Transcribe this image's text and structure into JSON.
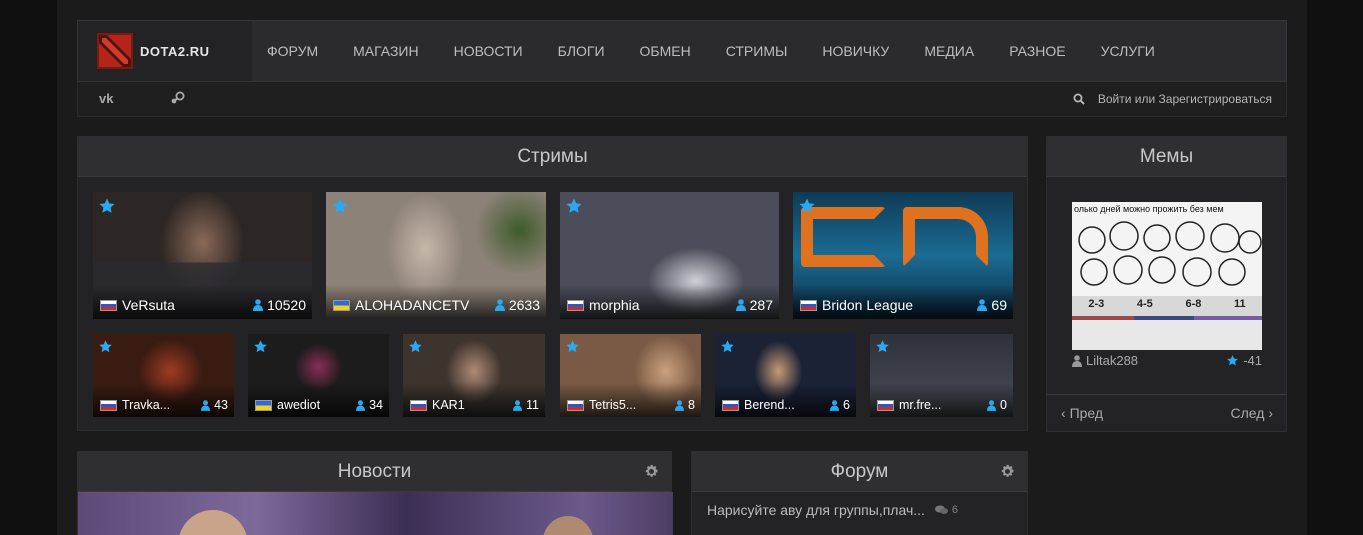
{
  "site": {
    "logo_text": "DOTA2.RU"
  },
  "nav": [
    "ФОРУМ",
    "МАГАЗИН",
    "НОВОСТИ",
    "БЛОГИ",
    "ОБМЕН",
    "СТРИМЫ",
    "НОВИЧКУ",
    "МЕДИА",
    "РАЗНОЕ",
    "УСЛУГИ"
  ],
  "subnav": {
    "vk": "vk",
    "login": "Войти или Зарегистрироваться"
  },
  "streams": {
    "title": "Стримы",
    "big": [
      {
        "name": "VeRsuta",
        "viewers": "10520",
        "flag": "ru"
      },
      {
        "name": "ALOHADANCETV",
        "viewers": "2633",
        "flag": "ua"
      },
      {
        "name": "morphia",
        "viewers": "287",
        "flag": "ru"
      },
      {
        "name": "Bridon League",
        "viewers": "69",
        "flag": "ru"
      }
    ],
    "small": [
      {
        "name": "Travka...",
        "viewers": "43",
        "flag": "ru"
      },
      {
        "name": "awediot",
        "viewers": "34",
        "flag": "ua"
      },
      {
        "name": "KAR1",
        "viewers": "11",
        "flag": "ru"
      },
      {
        "name": "Tetris5...",
        "viewers": "8",
        "flag": "ru"
      },
      {
        "name": "Berend...",
        "viewers": "6",
        "flag": "ru"
      },
      {
        "name": "mr.fre...",
        "viewers": "0",
        "flag": "ru"
      }
    ]
  },
  "memes": {
    "title": "Мемы",
    "caption": "олько дней можно прожить без мем",
    "scale": [
      "2-3",
      "4-5",
      "6-8",
      "11"
    ],
    "author": "Liltak288",
    "rating": "-41",
    "prev": "Пред",
    "next": "След"
  },
  "news": {
    "title": "Новости"
  },
  "forum": {
    "title": "Форум",
    "topic": "Нарисуйте аву для группы,плач...",
    "replies": "6"
  },
  "colors": {
    "accent": "#2aa8f0",
    "bg": "#1b1b1c",
    "panel_head": "#2f2f31"
  }
}
